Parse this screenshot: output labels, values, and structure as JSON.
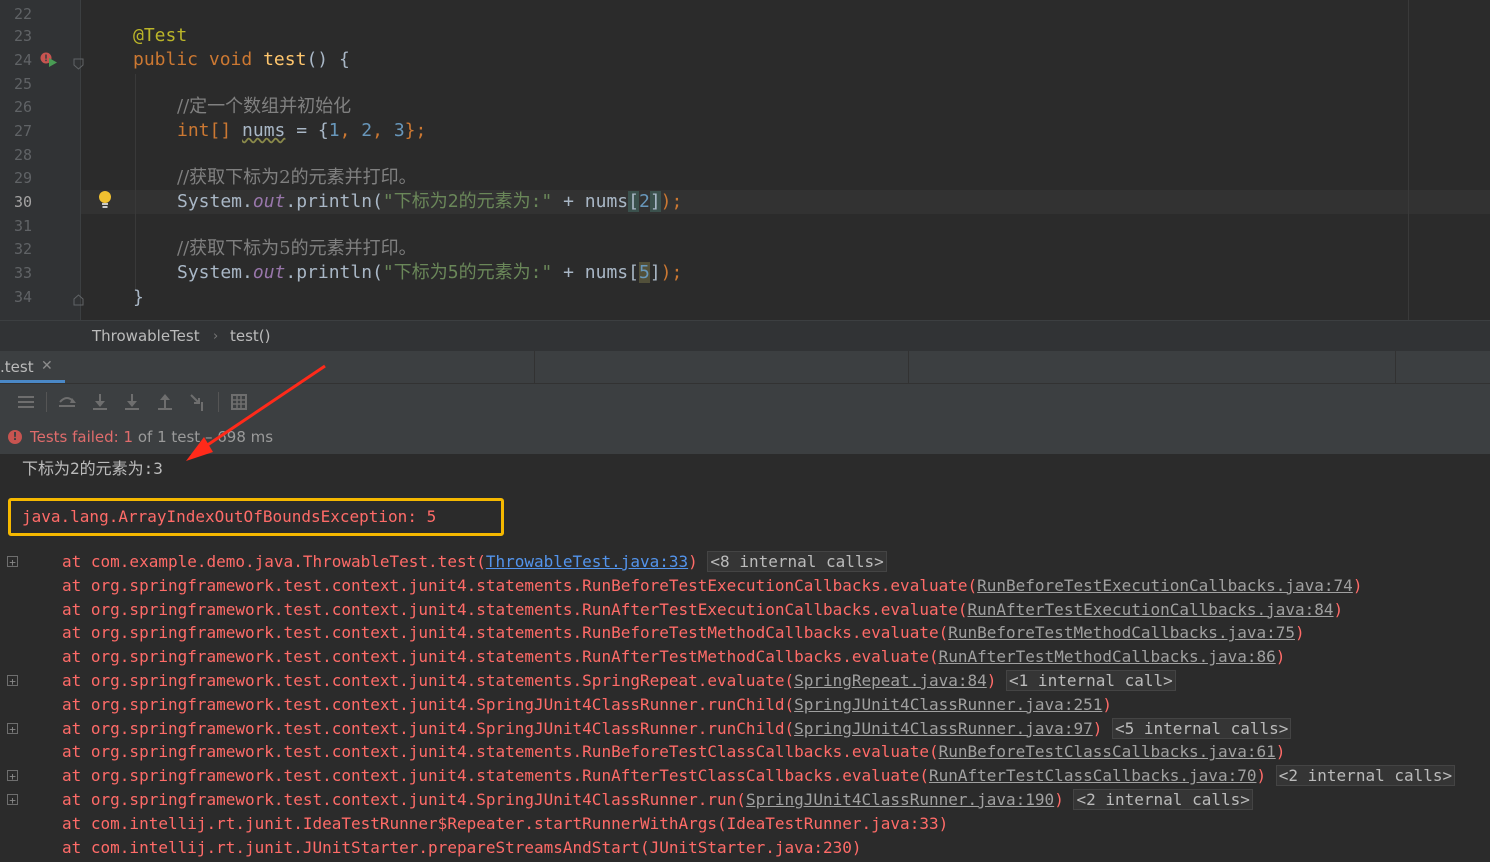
{
  "editor": {
    "line_numbers": [
      "22",
      "23",
      "24",
      "25",
      "26",
      "27",
      "28",
      "29",
      "30",
      "31",
      "32",
      "33",
      "34"
    ],
    "annotation": "@Test",
    "kw_public": "public",
    "kw_void": "void",
    "method_name": "test",
    "method_suffix": "() {",
    "comment1": "//定一个数组并初始化",
    "kw_int": "int[]",
    "var_nums": "nums",
    "assign": " = {",
    "n1": "1",
    "n2": "2",
    "n3": "3",
    "arr_end": "};",
    "comment2": "//获取下标为2的元素并打印。",
    "sys": "System.",
    "out": "out",
    "println": ".println(",
    "str1": "\"下标为2的元素为:\"",
    "plus_nums": " + nums",
    "idx2": "2",
    "close1": ");",
    "comment3": "//获取下标为5的元素并打印。",
    "str2": "\"下标为5的元素为:\"",
    "idx5": "5",
    "closing_brace": "}",
    "lbr": "[",
    "rbr": "]"
  },
  "breadcrumb": {
    "class_name": "ThrowableTest",
    "sep": "›",
    "method": "test()"
  },
  "run_tab": {
    "label": ".test",
    "close": "✕"
  },
  "status": {
    "failed_label": "Tests failed:",
    "count": "1",
    "of_text": "of 1 test –",
    "time": "698 ms"
  },
  "console": {
    "output": "下标为2的元素为:3",
    "exception": "java.lang.ArrayIndexOutOfBoundsException: 5",
    "stack": [
      {
        "text": "at com.example.demo.java.ThrowableTest.test(",
        "link": "ThrowableTest.java:33",
        "end": ")",
        "internal": "<8 internal calls>",
        "fold": true,
        "link_style": "blue"
      },
      {
        "text": "at org.springframework.test.context.junit4.statements.RunBeforeTestExecutionCallbacks.evaluate(",
        "link": "RunBeforeTestExecutionCallbacks.java:74",
        "end": ")",
        "internal": "",
        "fold": false,
        "link_style": "grey"
      },
      {
        "text": "at org.springframework.test.context.junit4.statements.RunAfterTestExecutionCallbacks.evaluate(",
        "link": "RunAfterTestExecutionCallbacks.java:84",
        "end": ")",
        "internal": "",
        "fold": false,
        "link_style": "grey"
      },
      {
        "text": "at org.springframework.test.context.junit4.statements.RunBeforeTestMethodCallbacks.evaluate(",
        "link": "RunBeforeTestMethodCallbacks.java:75",
        "end": ")",
        "internal": "",
        "fold": false,
        "link_style": "grey"
      },
      {
        "text": "at org.springframework.test.context.junit4.statements.RunAfterTestMethodCallbacks.evaluate(",
        "link": "RunAfterTestMethodCallbacks.java:86",
        "end": ")",
        "internal": "",
        "fold": false,
        "link_style": "grey"
      },
      {
        "text": "at org.springframework.test.context.junit4.statements.SpringRepeat.evaluate(",
        "link": "SpringRepeat.java:84",
        "end": ")",
        "internal": "<1 internal call>",
        "fold": true,
        "link_style": "grey"
      },
      {
        "text": "at org.springframework.test.context.junit4.SpringJUnit4ClassRunner.runChild(",
        "link": "SpringJUnit4ClassRunner.java:251",
        "end": ")",
        "internal": "",
        "fold": false,
        "link_style": "grey"
      },
      {
        "text": "at org.springframework.test.context.junit4.SpringJUnit4ClassRunner.runChild(",
        "link": "SpringJUnit4ClassRunner.java:97",
        "end": ")",
        "internal": "<5 internal calls>",
        "fold": true,
        "link_style": "grey"
      },
      {
        "text": "at org.springframework.test.context.junit4.statements.RunBeforeTestClassCallbacks.evaluate(",
        "link": "RunBeforeTestClassCallbacks.java:61",
        "end": ")",
        "internal": "",
        "fold": false,
        "link_style": "grey"
      },
      {
        "text": "at org.springframework.test.context.junit4.statements.RunAfterTestClassCallbacks.evaluate(",
        "link": "RunAfterTestClassCallbacks.java:70",
        "end": ")",
        "internal": "<2 internal calls>",
        "fold": true,
        "link_style": "grey"
      },
      {
        "text": "at org.springframework.test.context.junit4.SpringJUnit4ClassRunner.run(",
        "link": "SpringJUnit4ClassRunner.java:190",
        "end": ")",
        "internal": "<2 internal calls>",
        "fold": true,
        "link_style": "grey"
      },
      {
        "text": "at com.intellij.rt.junit.IdeaTestRunner$Repeater.startRunnerWithArgs(IdeaTestRunner.java:33)",
        "link": "",
        "end": "",
        "internal": "",
        "fold": false,
        "link_style": "none"
      },
      {
        "text": "at com.intellij.rt.junit.JUnitStarter.prepareStreamsAndStart(JUnitStarter.java:230)",
        "link": "",
        "end": "",
        "internal": "",
        "fold": false,
        "link_style": "none"
      }
    ]
  },
  "colors": {
    "accent": "#4a88c7",
    "error": "#ff6b68",
    "highlight_box": "#f5b800",
    "annotation_arrow": "#ff2a1a"
  }
}
